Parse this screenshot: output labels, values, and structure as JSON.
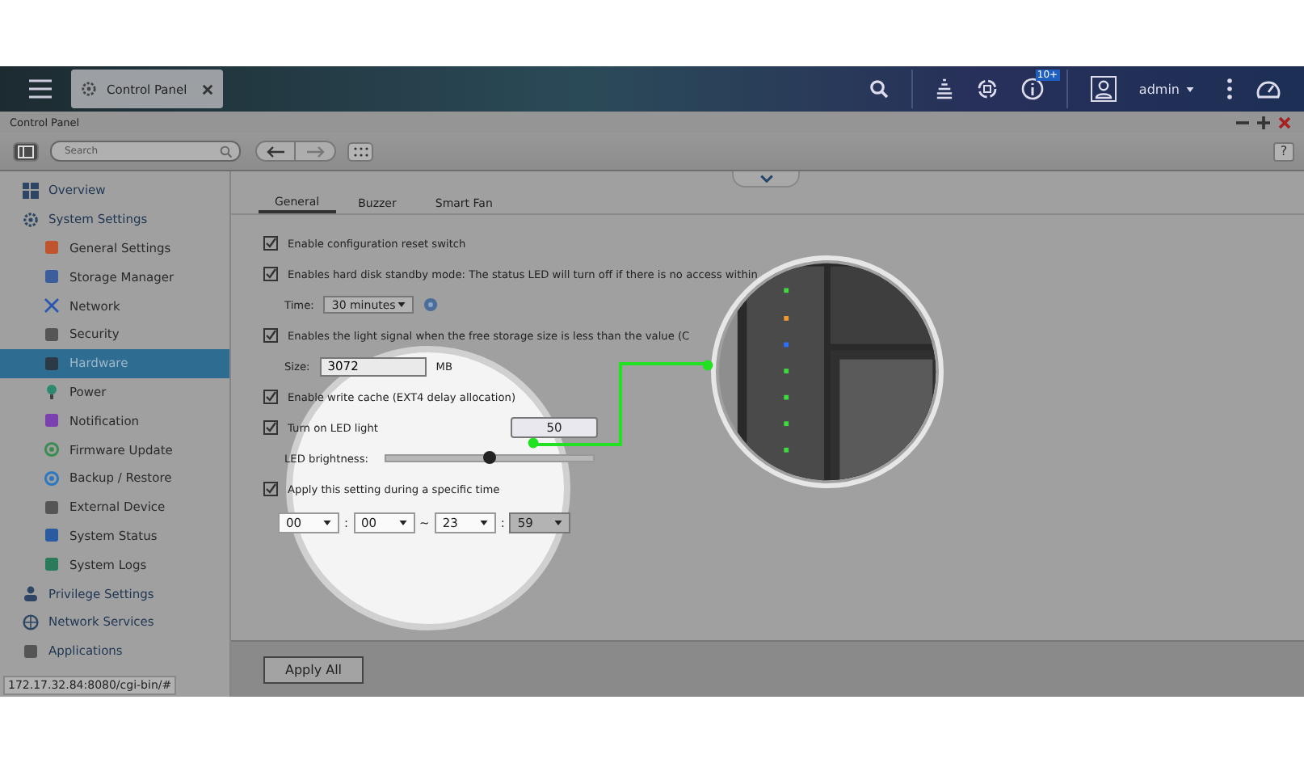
{
  "taskbar": {
    "tab_title": "Control Panel",
    "notification_badge": "10+",
    "user": "admin"
  },
  "window": {
    "title": "Control Panel",
    "search": {
      "placeholder": "Search"
    },
    "help": "?"
  },
  "sidebar": {
    "items": [
      {
        "label": "Overview",
        "selected": false
      },
      {
        "label": "System Settings",
        "selected": false,
        "children": [
          {
            "label": "General Settings",
            "selected": false
          },
          {
            "label": "Storage Manager",
            "selected": false
          },
          {
            "label": "Network",
            "selected": false
          },
          {
            "label": "Security",
            "selected": false
          },
          {
            "label": "Hardware",
            "selected": true
          },
          {
            "label": "Power",
            "selected": false
          },
          {
            "label": "Notification",
            "selected": false
          },
          {
            "label": "Firmware Update",
            "selected": false
          },
          {
            "label": "Backup / Restore",
            "selected": false
          },
          {
            "label": "External Device",
            "selected": false
          },
          {
            "label": "System Status",
            "selected": false
          },
          {
            "label": "System Logs",
            "selected": false
          }
        ]
      },
      {
        "label": "Privilege Settings",
        "selected": false
      },
      {
        "label": "Network Services",
        "selected": false
      },
      {
        "label": "Applications",
        "selected": false
      }
    ]
  },
  "tabs": [
    {
      "label": "General",
      "selected": true
    },
    {
      "label": "Buzzer",
      "selected": false
    },
    {
      "label": "Smart Fan",
      "selected": false
    }
  ],
  "settings": [
    {
      "kind": "checkbox",
      "label": "Enable configuration reset switch",
      "checked": true
    },
    {
      "kind": "checkbox",
      "label": "Enables hard disk standby mode: The status LED will turn off if there is no access within",
      "checked": true
    },
    {
      "kind": "select",
      "label": "Time:",
      "value": "30 minutes"
    },
    {
      "kind": "checkbox",
      "label": "Enables the light signal when the free storage size is less than the value (C",
      "checked": true
    },
    {
      "kind": "input",
      "label": "Size:",
      "value": "3072",
      "unit": "MB"
    },
    {
      "kind": "checkbox",
      "label": "Enable write cache (EXT4 delay allocation)",
      "checked": true
    },
    {
      "kind": "checkbox",
      "label": "Turn on LED light",
      "checked": true,
      "value": "50"
    },
    {
      "kind": "slider",
      "label": "LED brightness:",
      "level": 0.5
    },
    {
      "kind": "checkbox",
      "label": "Apply this setting during a specific time",
      "checked": true
    },
    {
      "kind": "time",
      "parts": [
        {
          "kind": "select",
          "value": "00"
        },
        {
          "kind": "separator",
          "text": ":"
        },
        {
          "kind": "select",
          "value": "00"
        },
        {
          "kind": "separator",
          "text": "~"
        },
        {
          "kind": "select",
          "value": "23"
        },
        {
          "kind": "separator",
          "text": ":"
        },
        {
          "kind": "select",
          "value": "59"
        }
      ]
    }
  ],
  "footer": {
    "button": "Apply All"
  },
  "status_url": "172.17.32.84:8080/cgi-bin/#"
}
